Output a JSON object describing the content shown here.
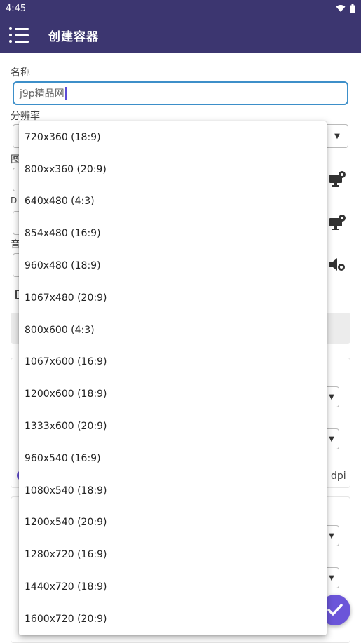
{
  "status": {
    "time": "4:45"
  },
  "appbar": {
    "title": "创建容器"
  },
  "form": {
    "name_label": "名称",
    "name_value": "j9p精品网",
    "resolution_label": "分辨率",
    "partial_labels": [
      "图",
      "D",
      "音"
    ]
  },
  "card": {
    "dpi_suffix": "dpi"
  },
  "resolution_options": [
    "720x360 (18:9)",
    "800xx360 (20:9)",
    "640x480 (4:3)",
    "854x480 (16:9)",
    "960x480 (18:9)",
    "1067x480 (20:9)",
    "800x600 (4:3)",
    "1067x600 (16:9)",
    "1200x600 (18:9)",
    "1333x600 (20:9)",
    "960x540 (16:9)",
    "1080x540 (18:9)",
    "1200x540 (20:9)",
    "1280x720 (16:9)",
    "1440x720 (18:9)",
    "1600x720 (20:9)"
  ],
  "icons": {
    "menu": "menu-icon",
    "wifi": "wifi-icon",
    "battery": "battery-icon",
    "display_settings": "display-settings-icon",
    "audio_settings": "audio-settings-icon",
    "confirm": "check-icon"
  },
  "colors": {
    "primary": "#3c3670",
    "accent": "#6b55d9",
    "focus_border": "#3d8fc9"
  }
}
